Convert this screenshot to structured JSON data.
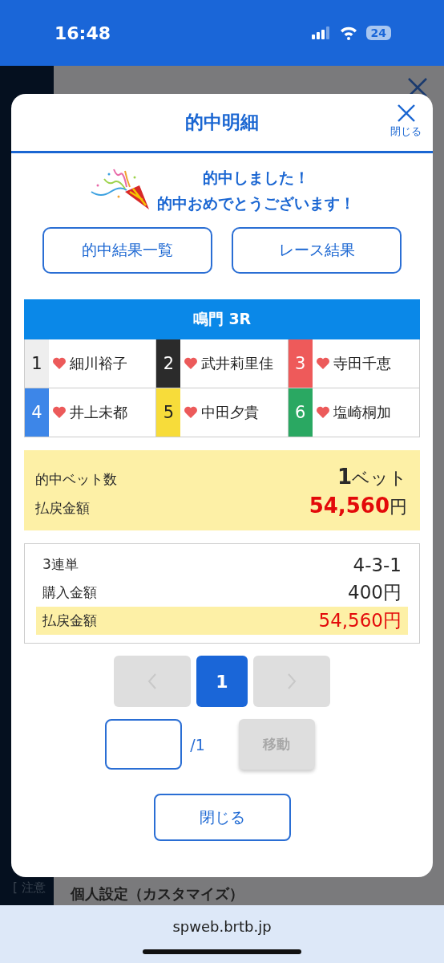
{
  "status_bar": {
    "time": "16:48",
    "battery": "24"
  },
  "background": {
    "notice": "[ 注意",
    "settings": "個人設定（カスタマイズ）"
  },
  "modal": {
    "title": "的中明細",
    "close_label": "閉じる",
    "message": [
      "的中しました！",
      "的中おめでとうございます！"
    ],
    "buttons": [
      "的中結果一覧",
      "レース結果"
    ],
    "race": "鳴門 3R",
    "racers": [
      {
        "number": "1",
        "name": "細川裕子",
        "color": "#eeeeee"
      },
      {
        "number": "2",
        "name": "武井莉里佳",
        "color": "#2b2b2b"
      },
      {
        "number": "3",
        "name": "寺田千恵",
        "color": "#ee5a5a"
      },
      {
        "number": "4",
        "name": "井上未都",
        "color": "#3d86e8"
      },
      {
        "number": "5",
        "name": "中田夕貴",
        "color": "#f7dc3a"
      },
      {
        "number": "6",
        "name": "塩崎桐加",
        "color": "#2aa862"
      }
    ],
    "summary": {
      "bets_label": "的中ベット数",
      "bets_count": "1",
      "bets_unit": "ベット",
      "payout_label": "払戻金額",
      "payout_value": "54,560",
      "payout_unit": "円"
    },
    "detail": [
      {
        "kind": "plain",
        "label": "3連単",
        "value": "4-3-1"
      },
      {
        "kind": "plain",
        "label": "購入金額",
        "value": "400円"
      },
      {
        "kind": "payout",
        "label": "払戻金額",
        "value": "54,560円"
      }
    ],
    "pager": {
      "prev_disabled": true,
      "next_disabled": true,
      "pages": [
        {
          "label": "1",
          "selected": true
        }
      ]
    },
    "jump": {
      "total": "/1",
      "button": "移動",
      "disabled": true
    },
    "close_button": "閉じる"
  },
  "browser": {
    "url": "spweb.brtb.jp"
  }
}
